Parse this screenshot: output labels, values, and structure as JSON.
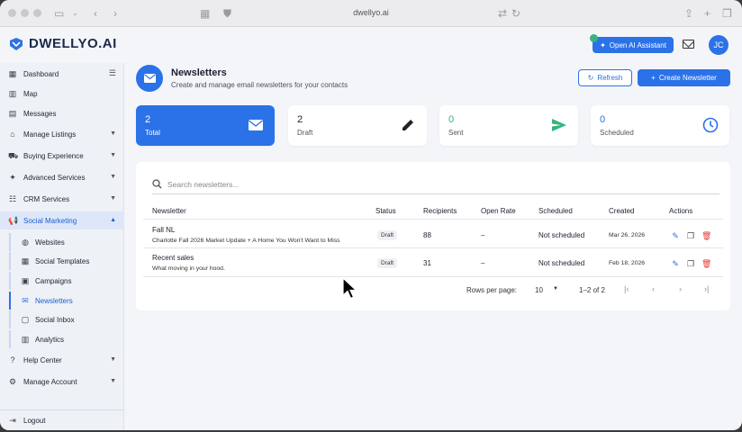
{
  "browser": {
    "url": "dwellyo.ai"
  },
  "header": {
    "brand": "DWELLYO.AI",
    "ai_button": "Open AI Assistant",
    "avatar_initials": "JC"
  },
  "sidebar": {
    "items": [
      {
        "label": "Dashboard"
      },
      {
        "label": "Map"
      },
      {
        "label": "Messages"
      },
      {
        "label": "Manage Listings"
      },
      {
        "label": "Buying Experience"
      },
      {
        "label": "Advanced Services"
      },
      {
        "label": "CRM Services"
      },
      {
        "label": "Social Marketing"
      },
      {
        "label": "Help Center"
      },
      {
        "label": "Manage Account"
      },
      {
        "label": "Logout"
      }
    ],
    "sub_items": [
      {
        "label": "Websites"
      },
      {
        "label": "Social Templates"
      },
      {
        "label": "Campaigns"
      },
      {
        "label": "Newsletters"
      },
      {
        "label": "Social Inbox"
      },
      {
        "label": "Analytics"
      }
    ]
  },
  "page": {
    "title": "Newsletters",
    "subtitle": "Create and manage email newsletters for your contacts",
    "refresh_label": "Refresh",
    "create_label": "Create Newsletter"
  },
  "stats": [
    {
      "value": "2",
      "label": "Total"
    },
    {
      "value": "2",
      "label": "Draft"
    },
    {
      "value": "0",
      "label": "Sent"
    },
    {
      "value": "0",
      "label": "Scheduled"
    }
  ],
  "table": {
    "search_placeholder": "Search newsletters...",
    "columns": [
      "Newsletter",
      "Status",
      "Recipients",
      "Open Rate",
      "Scheduled",
      "Created",
      "Actions"
    ],
    "rows": [
      {
        "name": "Fall NL",
        "subject": "Charlotte Fall 2026 Market Update + A Home You Won't Want to Miss",
        "status": "Draft",
        "recipients": "88",
        "open_rate": "–",
        "scheduled": "Not scheduled",
        "created": "Mar 26, 2026"
      },
      {
        "name": "Recent sales",
        "subject": "What moving in your hood.",
        "status": "Draft",
        "recipients": "31",
        "open_rate": "–",
        "scheduled": "Not scheduled",
        "created": "Feb 18, 2026"
      }
    ],
    "rows_per_page_label": "Rows per page:",
    "rows_per_page": "10",
    "range": "1–2 of 2"
  },
  "colors": {
    "accent": "#2b72e8",
    "success": "#36b37e",
    "danger": "#e53935"
  }
}
